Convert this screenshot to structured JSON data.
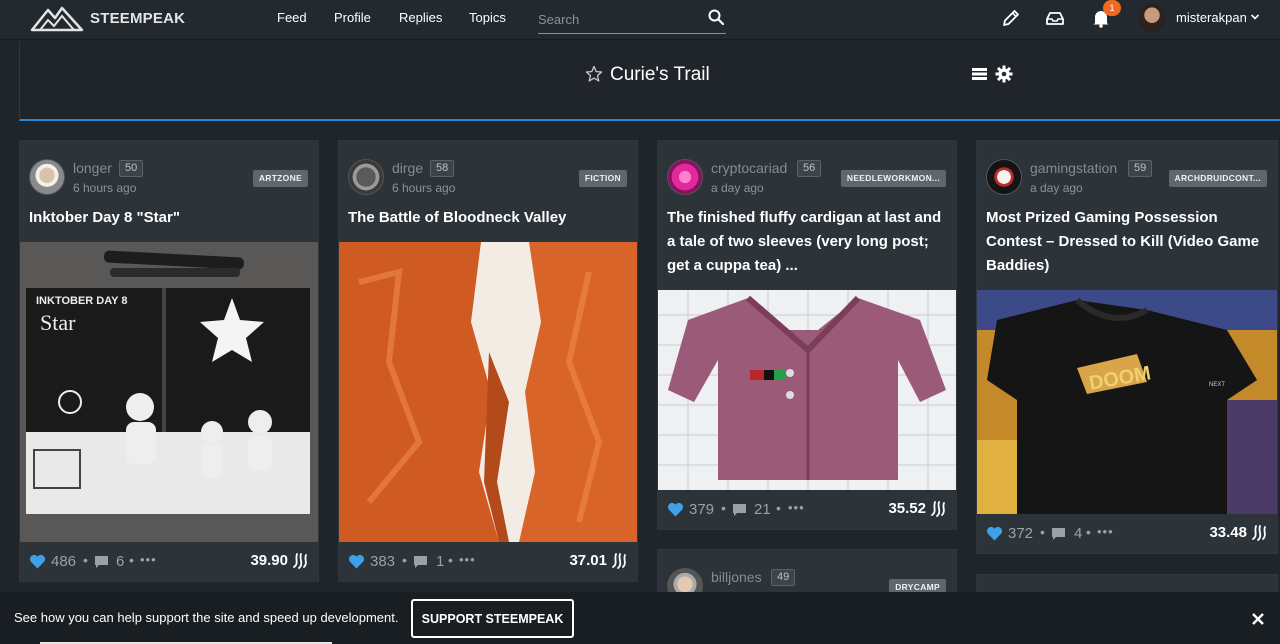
{
  "app": {
    "brand": "STEEMPEAK",
    "nav": [
      "Feed",
      "Profile",
      "Replies",
      "Topics"
    ],
    "search_placeholder": "Search",
    "notification_count": "1",
    "username": "misterakpan"
  },
  "page": {
    "title": "Curie's Trail"
  },
  "posts": [
    {
      "author": "longer",
      "reputation": "50",
      "time": "6 hours ago",
      "tag": "ARTZONE",
      "title": "Inktober Day 8 \"Star\"",
      "thumbnail": "ink-drawing-astronauts-star",
      "votes": "486",
      "comments": "6",
      "payout": "39.90"
    },
    {
      "author": "dirge",
      "reputation": "58",
      "time": "6 hours ago",
      "tag": "FICTION",
      "title": "The Battle of Bloodneck Valley",
      "thumbnail": "orange-canyon-rocks",
      "votes": "383",
      "comments": "1",
      "payout": "37.01"
    },
    {
      "author": "cryptocariad",
      "reputation": "56",
      "time": "a day ago",
      "tag": "NEEDLEWORKMON...",
      "title": "The finished fluffy cardigan at last and a tale of two sleeves (very long post; get a cuppa tea) ...",
      "thumbnail": "pink-knitted-cardigan",
      "votes": "379",
      "comments": "21",
      "payout": "35.52"
    },
    {
      "author": "gamingstation",
      "reputation": "59",
      "time": "a day ago",
      "tag": "ARCHDRUIDCONT...",
      "title": "Most Prized Gaming Possession Contest – Dressed to Kill (Video Game Baddies)",
      "thumbnail": "doom-black-tshirt",
      "votes": "372",
      "comments": "4",
      "payout": "33.48"
    },
    {
      "author": "billjones",
      "reputation": "49",
      "tag": "DRYCAMP"
    }
  ],
  "footer": {
    "message": "See how you can help support the site and speed up development.",
    "button": "SUPPORT STEEMPEAK"
  },
  "colors": {
    "background": "#1f252a",
    "card": "#2c3339",
    "accent_blue": "#2a88d6",
    "vote_heart": "#3fa0ea",
    "notification_badge": "#f26a22"
  }
}
